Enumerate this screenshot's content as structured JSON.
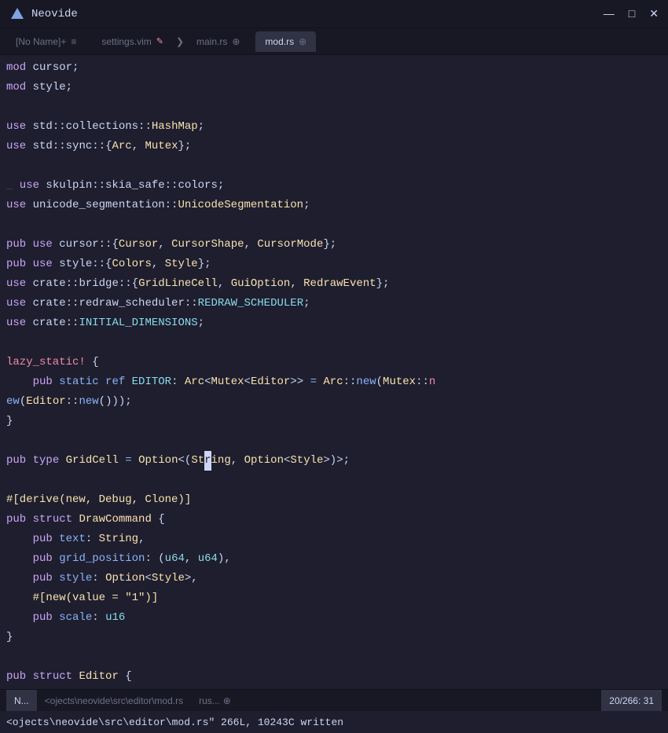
{
  "titlebar": {
    "app_name": "Neovide",
    "minimize": "—",
    "maximize": "□",
    "close": "✕"
  },
  "tabs": [
    {
      "label": "[No Name]+",
      "icon": "≡",
      "active": false
    },
    {
      "label": "settings.vim",
      "modified": "✎",
      "active": false
    },
    {
      "label": "main.rs",
      "icon": "⊕",
      "active": false
    },
    {
      "label": "mod.rs",
      "icon": "⊕",
      "active": true
    }
  ],
  "statusbar": {
    "mode": "N...",
    "file_path": "<ojects\\neovide\\src\\editor\\mod.rs",
    "filetype": "rus...",
    "encoding_icon": "⊕",
    "position": "20/266: 31"
  },
  "cmdline": {
    "text": "<ojects\\neovide\\src\\editor\\mod.rs\" 266L, 10243C written"
  }
}
